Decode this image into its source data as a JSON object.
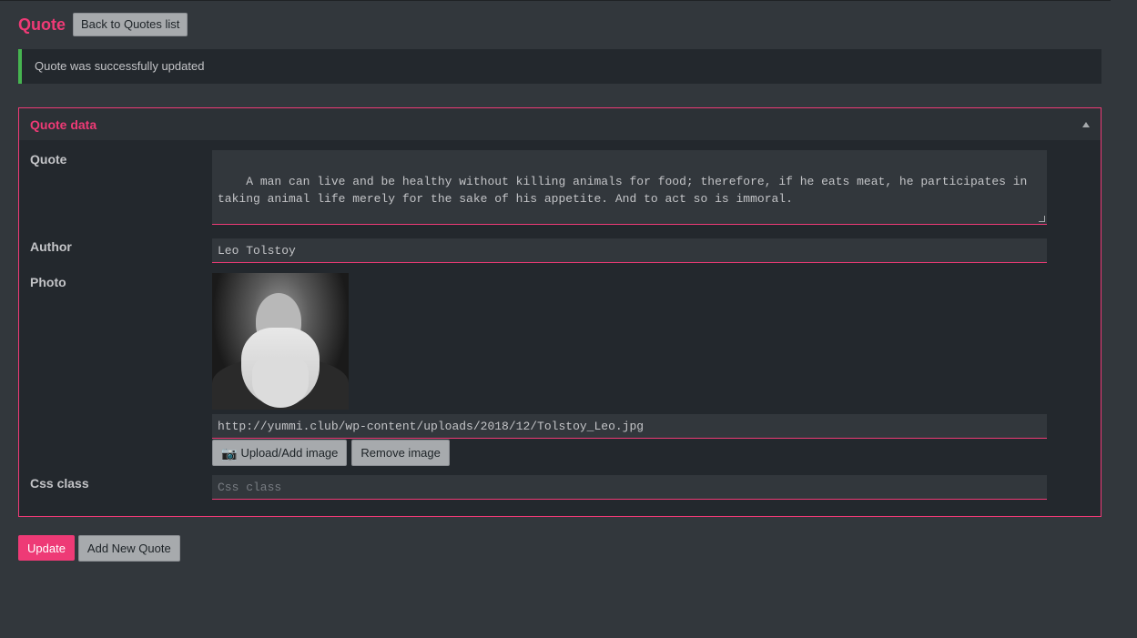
{
  "header": {
    "title": "Quote",
    "back_button_label": "Back to Quotes list"
  },
  "notice": {
    "message": "Quote was successfully updated",
    "accent_color": "#46b450"
  },
  "panel": {
    "title": "Quote data",
    "toggle_icon": "triangle-up-icon",
    "fields": {
      "quote": {
        "label": "Quote",
        "value": "A man can live and be healthy without killing animals for food; therefore, if he eats meat, he participates in taking animal life merely for the sake of his appetite. And to act so is immoral."
      },
      "author": {
        "label": "Author",
        "value": "Leo Tolstoy"
      },
      "photo": {
        "label": "Photo",
        "url": "http://yummi.club/wp-content/uploads/2018/12/Tolstoy_Leo.jpg",
        "upload_label": "Upload/Add image",
        "remove_label": "Remove image"
      },
      "css_class": {
        "label": "Css class",
        "value": "",
        "placeholder": "Css class"
      }
    }
  },
  "actions": {
    "update_label": "Update",
    "add_new_label": "Add New Quote"
  },
  "colors": {
    "accent": "#ee3a76",
    "background": "#32373c",
    "panel": "#23282d"
  }
}
